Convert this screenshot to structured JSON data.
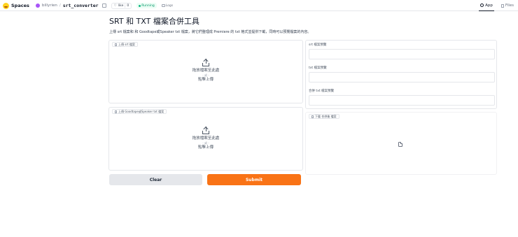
{
  "topbar": {
    "spaces_label": "Spaces",
    "owner": "billyrien",
    "separator": "/",
    "repo": "srt_converter",
    "like_label": "like",
    "like_count": "0",
    "status": "Running",
    "logs_label": "Logs",
    "tabs": [
      {
        "label": "App",
        "active": true
      },
      {
        "label": "Files",
        "active": false
      }
    ]
  },
  "page": {
    "title": "SRT 和 TXT 檔案合併工具",
    "description": "上傳 srt 檔案和 和 Goodtape或Speaker txt 檔案，將它們整理成 Premiere 的 txt 格式並提供下載，同時可以預覽檔案的內容。"
  },
  "inputs": {
    "srt_upload": {
      "label": "上傳 srt 檔案",
      "drop_text": "拖放檔案至此處",
      "or_text": "- 或 -",
      "click_text": "點擊上傳"
    },
    "txt_upload": {
      "label": "上傳 Goodtape或Speaker txt 檔案",
      "drop_text": "拖放檔案至此處",
      "or_text": "- 或 -",
      "click_text": "點擊上傳"
    }
  },
  "outputs": {
    "srt_preview_label": "srt 檔案預覽",
    "txt_preview_label": "txt 檔案預覽",
    "merged_preview_label": "合併 txt 檔案預覽",
    "download_label": "下載 合併後 檔案"
  },
  "buttons": {
    "clear": "Clear",
    "submit": "Submit"
  },
  "colors": {
    "accent": "#f97316",
    "running": "#059669",
    "avatar": "#a855f7"
  }
}
